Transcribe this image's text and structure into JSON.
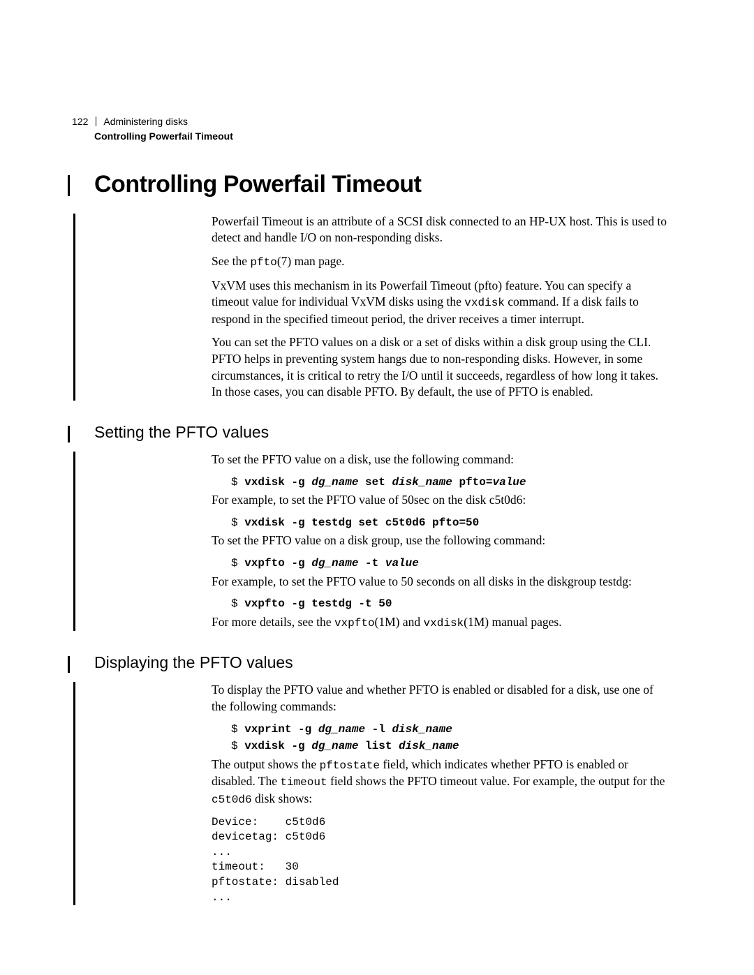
{
  "header": {
    "page_number": "122",
    "chapter": "Administering disks",
    "section": "Controlling Powerfail Timeout"
  },
  "h1": "Controlling Powerfail Timeout",
  "intro": {
    "p1": "Powerfail Timeout is an attribute of a SCSI disk connected to an HP-UX host. This is used to detect and handle I/O on non-responding disks.",
    "p2a": "See the ",
    "p2_cmd": "pfto",
    "p2b": "(7) man page.",
    "p3a": "VxVM uses this mechanism in its Powerfail Timeout (pfto) feature. You can specify a timeout value for individual VxVM disks using the ",
    "p3_cmd": "vxdisk",
    "p3b": " command. If a disk fails to respond in the specified timeout period, the driver receives a timer interrupt.",
    "p4": "You can set the PFTO values on a disk or a set of disks within a disk group using the CLI. PFTO helps in preventing system hangs due to non-responding disks. However, in some circumstances, it is critical to retry the I/O until it succeeds, regardless of how long it takes. In those cases, you can disable PFTO. By default, the use of PFTO is enabled."
  },
  "setting": {
    "heading": "Setting the PFTO values",
    "p1": "To set the PFTO value on a disk, use the following command:",
    "cmd1": {
      "dollar": "$ ",
      "b1": "vxdisk -g ",
      "bi1": "dg_name",
      "b2": " set ",
      "bi2": "disk_name",
      "b3": " pfto=",
      "bi3": "value"
    },
    "p2": "For example, to set the PFTO value of 50sec on the disk c5t0d6:",
    "cmd2": {
      "dollar": "$ ",
      "b1": "vxdisk -g testdg set c5t0d6 pfto=50"
    },
    "p3": "To set the PFTO value on a disk group, use the following command:",
    "cmd3": {
      "dollar": "$ ",
      "b1": "vxpfto -g ",
      "bi1": "dg_name",
      "b2": " -t ",
      "bi2": "value"
    },
    "p4": "For example, to set the PFTO value to 50 seconds on all disks in the diskgroup testdg:",
    "cmd4": {
      "dollar": "$ ",
      "b1": "vxpfto -g testdg -t 50"
    },
    "p5a": "For more details, see the ",
    "p5_cmd1": "vxpfto",
    "p5b": "(1M) and ",
    "p5_cmd2": "vxdisk",
    "p5c": "(1M) manual pages."
  },
  "displaying": {
    "heading": "Displaying the PFTO values",
    "p1": "To display the PFTO value and whether PFTO is enabled or disabled for a disk, use one of the following commands:",
    "cmd1": {
      "dollar": "$ ",
      "b1": "vxprint -g ",
      "bi1": "dg_name",
      "b2": " -l ",
      "bi2": "disk_name"
    },
    "cmd2": {
      "dollar": "$ ",
      "b1": "vxdisk -g ",
      "bi1": "dg_name",
      "b2": " list ",
      "bi2": "disk_name"
    },
    "p2a": "The output shows the ",
    "p2_cmd1": "pftostate",
    "p2b": " field, which indicates whether PFTO is enabled or disabled. The ",
    "p2_cmd2": "timeout",
    "p2c": " field shows the PFTO timeout value. For example, the output for the ",
    "p2_cmd3": "c5t0d6",
    "p2d": " disk shows:",
    "output": "Device:    c5t0d6\ndevicetag: c5t0d6\n...\ntimeout:   30\npftostate: disabled\n..."
  }
}
